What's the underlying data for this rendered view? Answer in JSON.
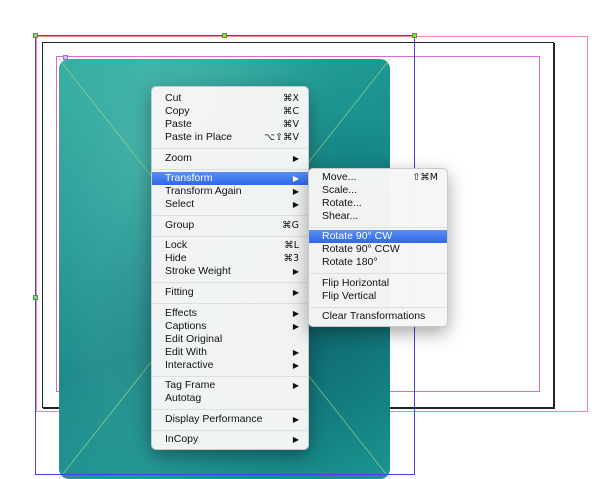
{
  "main_menu": {
    "items": [
      {
        "label": "Cut",
        "shortcut": "⌘X"
      },
      {
        "label": "Copy",
        "shortcut": "⌘C"
      },
      {
        "label": "Paste",
        "shortcut": "⌘V"
      },
      {
        "label": "Paste in Place",
        "shortcut": "⌥⇧⌘V"
      },
      {
        "label": "Zoom",
        "arrow": "▶"
      },
      {
        "label": "Transform",
        "arrow": "▶"
      },
      {
        "label": "Transform Again",
        "arrow": "▶"
      },
      {
        "label": "Select",
        "arrow": "▶"
      },
      {
        "label": "Group",
        "shortcut": "⌘G"
      },
      {
        "label": "Lock",
        "shortcut": "⌘L"
      },
      {
        "label": "Hide",
        "shortcut": "⌘3"
      },
      {
        "label": "Stroke Weight",
        "arrow": "▶"
      },
      {
        "label": "Fitting",
        "arrow": "▶"
      },
      {
        "label": "Effects",
        "arrow": "▶"
      },
      {
        "label": "Captions",
        "arrow": "▶"
      },
      {
        "label": "Edit Original"
      },
      {
        "label": "Edit With",
        "arrow": "▶"
      },
      {
        "label": "Interactive",
        "arrow": "▶"
      },
      {
        "label": "Tag Frame",
        "arrow": "▶"
      },
      {
        "label": "Autotag"
      },
      {
        "label": "Display Performance",
        "arrow": "▶"
      },
      {
        "label": "InCopy",
        "arrow": "▶"
      }
    ]
  },
  "transform_submenu": {
    "items": [
      {
        "label": "Move...",
        "shortcut": "⇧⌘M"
      },
      {
        "label": "Scale..."
      },
      {
        "label": "Rotate..."
      },
      {
        "label": "Shear..."
      },
      {
        "label": "Rotate 90° CW"
      },
      {
        "label": "Rotate 90° CCW"
      },
      {
        "label": "Rotate 180°"
      },
      {
        "label": "Flip Horizontal"
      },
      {
        "label": "Flip Vertical"
      },
      {
        "label": "Clear Transformations"
      }
    ]
  },
  "colors": {
    "highlight": "#3a72ea",
    "image": "#188f8c",
    "bleed_guide": "#f08aa0",
    "margin_guide": "#d86ad8",
    "selection": "#4444dd"
  }
}
